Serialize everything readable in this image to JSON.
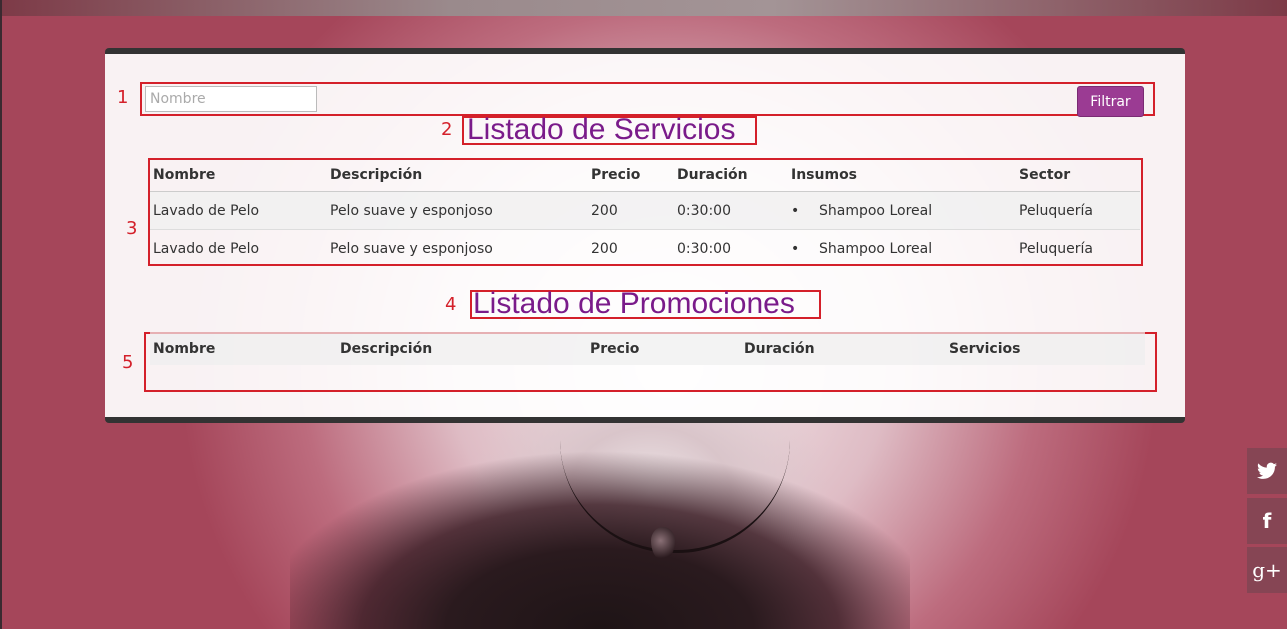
{
  "filter": {
    "placeholder": "Nombre",
    "button_label": "Filtrar"
  },
  "annotations": [
    "1",
    "2",
    "3",
    "4",
    "5"
  ],
  "servicios": {
    "title": "Listado de Servicios",
    "headers": [
      "Nombre",
      "Descripción",
      "Precio",
      "Duración",
      "Insumos",
      "Sector"
    ],
    "rows": [
      {
        "nombre": "Lavado de Pelo",
        "descripcion": "Pelo suave y esponjoso",
        "precio": "200",
        "duracion": "0:30:00",
        "insumos": "Shampoo Loreal",
        "sector": "Peluquería"
      },
      {
        "nombre": "Lavado de Pelo",
        "descripcion": "Pelo suave y esponjoso",
        "precio": "200",
        "duracion": "0:30:00",
        "insumos": "Shampoo Loreal",
        "sector": "Peluquería"
      }
    ]
  },
  "promociones": {
    "title": "Listado de Promociones",
    "headers": [
      "Nombre",
      "Descripción",
      "Precio",
      "Duración",
      "Servicios"
    ]
  },
  "social": [
    {
      "icon": "twitter-icon",
      "glyph": "🐦"
    },
    {
      "icon": "facebook-icon",
      "glyph": "f"
    },
    {
      "icon": "google-plus-icon",
      "glyph": "g+"
    }
  ],
  "colors": {
    "accent_button": "#9b3b93",
    "heading": "#7a1b8a",
    "annotation": "#d4202a"
  }
}
